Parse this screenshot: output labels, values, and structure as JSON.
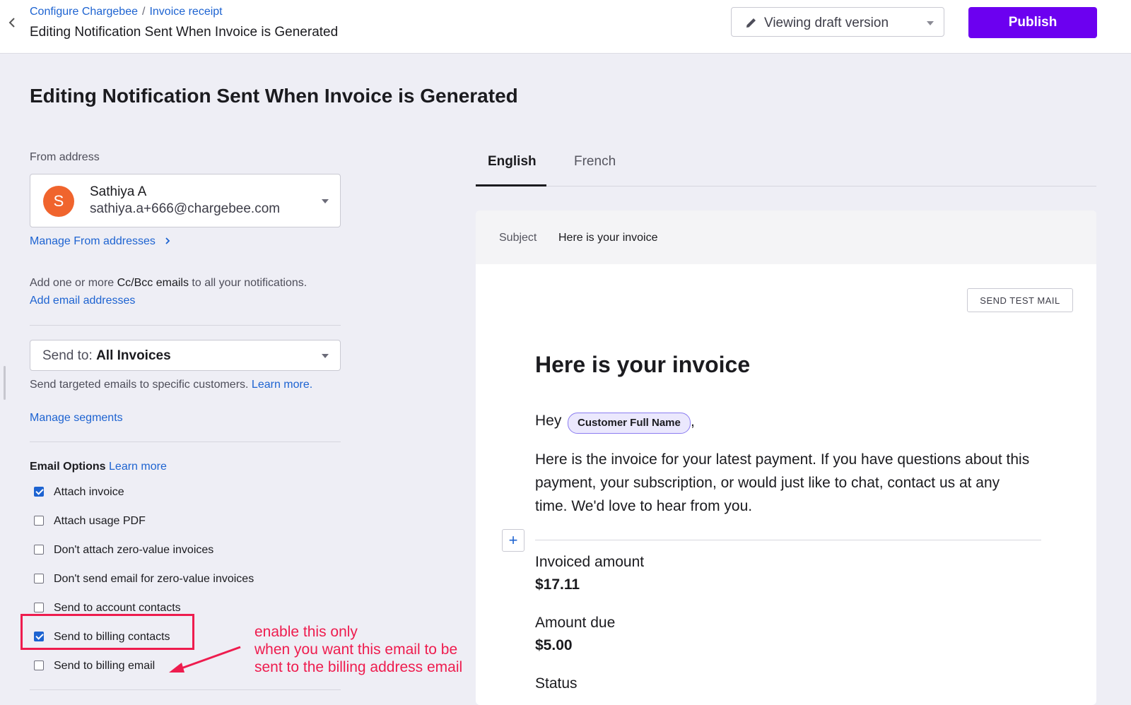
{
  "header": {
    "breadcrumbs": [
      "Configure Chargebee",
      "Invoice receipt"
    ],
    "breadcrumb_sep": "/",
    "title": "Editing Notification Sent When Invoice is Generated",
    "version_label": "Viewing draft version",
    "publish_label": "Publish"
  },
  "page": {
    "title": "Editing Notification Sent When Invoice is Generated"
  },
  "from": {
    "label": "From address",
    "avatar_letter": "S",
    "name": "Sathiya A",
    "email": "sathiya.a+666@chargebee.com",
    "manage_link": "Manage From addresses",
    "avatar_color": "#f0642d"
  },
  "cc": {
    "text_prefix": "Add one or more ",
    "text_bold": "Cc/Bcc emails",
    "text_suffix": " to all your notifications.",
    "link": "Add email addresses"
  },
  "send_to": {
    "prefix": "Send to: ",
    "value": "All Invoices",
    "help": "Send targeted emails to specific customers. ",
    "help_link": "Learn more.",
    "manage_segments": "Manage segments"
  },
  "email_options": {
    "title": "Email Options",
    "learn_more": "Learn more",
    "items": [
      {
        "label": "Attach invoice",
        "checked": true
      },
      {
        "label": "Attach usage PDF",
        "checked": false
      },
      {
        "label": "Don't attach zero-value invoices",
        "checked": false
      },
      {
        "label": "Don't send email for zero-value invoices",
        "checked": false
      },
      {
        "label": "Send to account contacts",
        "checked": false
      },
      {
        "label": "Send to billing contacts",
        "checked": true
      },
      {
        "label": "Send to billing email",
        "checked": false
      }
    ]
  },
  "annotation": {
    "lines": [
      "enable this only",
      "when you want this email to be",
      "sent to the billing address email"
    ],
    "color": "#ee1c4e"
  },
  "tabs": [
    {
      "label": "English",
      "active": true
    },
    {
      "label": "French",
      "active": false
    }
  ],
  "preview": {
    "subject_label": "Subject",
    "subject_value": "Here is your invoice",
    "send_test": "SEND TEST MAIL",
    "heading": "Here is your invoice",
    "greeting": "Hey",
    "placeholder": "Customer Full Name",
    "greeting_end": ",",
    "body": "Here is the invoice for your latest payment. If you have questions about this payment, your subscription, or would just like to chat, contact us at any time. We'd love to hear from you.",
    "fields": [
      {
        "label": "Invoiced amount",
        "value": "$17.11"
      },
      {
        "label": "Amount due",
        "value": "$5.00"
      },
      {
        "label": "Status",
        "value": ""
      }
    ]
  },
  "colors": {
    "accent": "#6c00f0",
    "link": "#1d63d1"
  }
}
